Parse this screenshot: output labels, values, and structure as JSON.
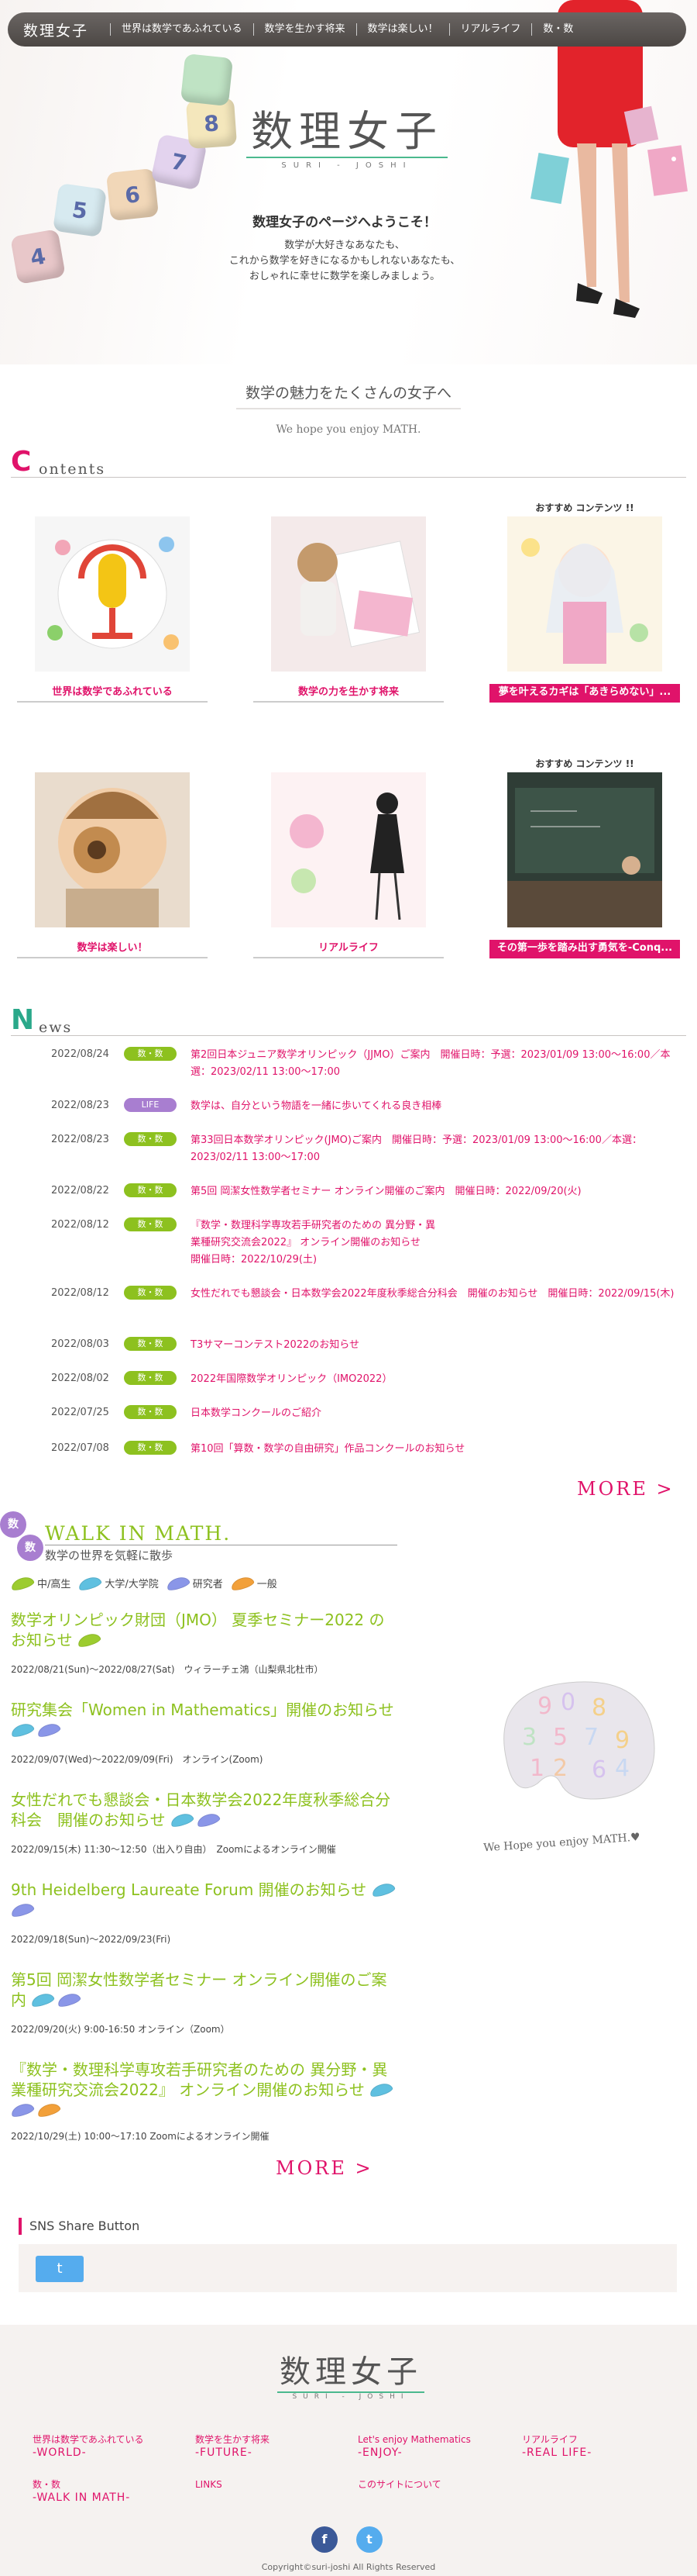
{
  "nav": {
    "logo": "数理女子",
    "items": [
      "世界は数学であふれている",
      "数学を生かす将来",
      "数学は楽しい！",
      "リアルライフ",
      "数・数"
    ]
  },
  "hero": {
    "title": "数理女子",
    "subtitle": "SURI - JOSHI",
    "welcome": "数理女子のページへようこそ！",
    "lines": [
      "数学が大好きなあなたも、",
      "これから数学を好きになるかもしれないあなたも、",
      "おしゃれに幸せに数学を楽しみましょう。"
    ],
    "dice": [
      "4",
      "5",
      "6",
      "7",
      "8"
    ]
  },
  "tagline": {
    "jp": "数学の魅力をたくさんの女子へ",
    "en": "We hope you enjoy MATH."
  },
  "contents": {
    "icon": "C",
    "label": "ontents",
    "recommend": "おすすめ コンテンツ !!",
    "cards": [
      {
        "label": "世界は数学であふれている"
      },
      {
        "label": "数学の力を生かす将来"
      },
      {
        "label": "夢を叶えるカギは「あきらめない」..."
      },
      {
        "label": "数学は楽しい！"
      },
      {
        "label": "リアルライフ"
      },
      {
        "label": "その第一歩を踏み出す勇気を-Conq..."
      }
    ]
  },
  "news": {
    "icon": "N",
    "label": "ews",
    "items": [
      {
        "date": "2022/08/24",
        "badge": "数・数",
        "title": "第2回日本ジュニア数学オリンピック（JJMO）ご案内　開催日時：予選：2023/01/09 13:00〜16:00／本選：2023/02/11 13:00〜17:00"
      },
      {
        "date": "2022/08/23",
        "badge": "LIFE",
        "title": "数学は、自分という物語を一緒に歩いてくれる良き相棒"
      },
      {
        "date": "2022/08/23",
        "badge": "数・数",
        "title": "第33回日本数学オリンピック(JMO)ご案内　開催日時：予選：2023/01/09 13:00〜16:00／本選：2023/02/11 13:00〜17:00"
      },
      {
        "date": "2022/08/22",
        "badge": "数・数",
        "title": "第5回 岡潔女性数学者セミナー オンライン開催のご案内　開催日時：2022/09/20(火)"
      },
      {
        "date": "2022/08/12",
        "badge": "数・数",
        "title": "『数学・数理科学専攻若手研究者のための 異分野・異業種研究交流会2022』 オンライン開催のお知らせ　開催日時：2022/10/29(土)"
      },
      {
        "date": "2022/08/12",
        "badge": "数・数",
        "title": "女性だれでも懇談会・日本数学会2022年度秋季総合分科会　開催のお知らせ　開催日時：2022/09/15(木)"
      },
      {
        "date": "2022/08/03",
        "badge": "数・数",
        "title": "T3サマーコンテスト2022のお知らせ"
      },
      {
        "date": "2022/08/02",
        "badge": "数・数",
        "title": "2022年国際数学オリンピック（IMO2022）"
      },
      {
        "date": "2022/07/25",
        "badge": "数・数",
        "title": "日本数学コンクールのご紹介"
      },
      {
        "date": "2022/07/08",
        "badge": "数・数",
        "title": "第10回「算数・数学の自由研究」作品コンクールのお知らせ"
      }
    ],
    "more": "MORE >"
  },
  "walk": {
    "badge1": "数",
    "badge2": "数",
    "title": "WALK IN MATH.",
    "subtitle": "数学の世界を気軽に散歩",
    "legend": [
      {
        "label": "中/高生",
        "color": "#9ccc2f"
      },
      {
        "label": "大学/大学院",
        "color": "#5fc0e0"
      },
      {
        "label": "研究者",
        "color": "#8a96e8"
      },
      {
        "label": "一般",
        "color": "#f2a03a"
      }
    ],
    "items": [
      {
        "title": "数学オリンピック財団（JMO） 夏季セミナー2022 のお知らせ",
        "detail": "2022/08/21(Sun)〜2022/08/27(Sat)　ウィラーチェ鴻（山梨県北杜市）"
      },
      {
        "title": "研究集会「Women in Mathematics」開催のお知らせ",
        "detail": "2022/09/07(Wed)〜2022/09/09(Fri)　オンライン(Zoom)"
      },
      {
        "title": "女性だれでも懇談会・日本数学会2022年度秋季総合分科会　開催のお知らせ",
        "detail": "2022/09/15(木) 11:30〜12:50（出入り自由）　Zoomによるオンライン開催"
      },
      {
        "title": "9th Heidelberg Laureate Forum 開催のお知らせ",
        "detail": "2022/09/18(Sun)〜2022/09/23(Fri)"
      },
      {
        "title": "第5回 岡潔女性数学者セミナー オンライン開催のご案内",
        "detail": "2022/09/20(火) 9:00-16:50 オンライン（Zoom）"
      },
      {
        "title": "『数学・数理科学専攻若手研究者のための 異分野・異業種研究交流会2022』 オンライン開催のお知らせ",
        "detail": "2022/10/29(土) 10:00〜17:10 Zoomによるオンライン開催"
      }
    ],
    "more": "MORE >",
    "palette_text": "We Hope you enjoy MATH.♥"
  },
  "sns": {
    "heading": "SNS Share Button",
    "twitter": "t"
  },
  "footer": {
    "logo": "数理女子",
    "logo_sub": "SURI - JOSHI",
    "links": [
      {
        "jp": "世界は数学であふれている",
        "en": "-WORLD-"
      },
      {
        "jp": "数学を生かす将来",
        "en": "-FUTURE-"
      },
      {
        "jp": "Let's enjoy Mathematics",
        "en": "-ENJOY-"
      },
      {
        "jp": "リアルライフ",
        "en": "-REAL LIFE-"
      },
      {
        "jp": "数・数",
        "en": "-WALK IN MATH-"
      },
      {
        "jp": "LINKS",
        "en": ""
      },
      {
        "jp": "このサイトについて",
        "en": ""
      }
    ],
    "facebook": "f",
    "twitter": "t",
    "copyright": "Copyright©suri-joshi All Rights Reserved"
  }
}
